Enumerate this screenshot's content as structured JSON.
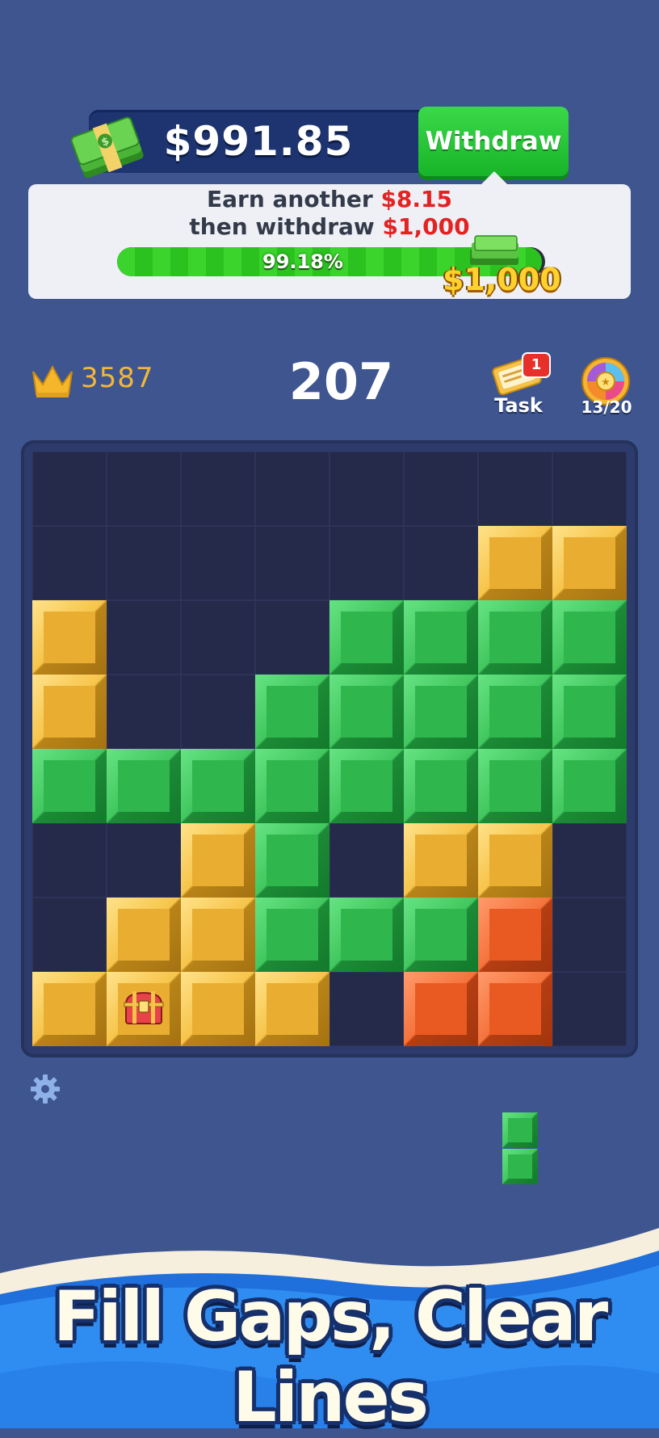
{
  "header": {
    "balance": "$991.85",
    "withdraw_label": "Withdraw"
  },
  "info_card": {
    "line1_text": "Earn another ",
    "line1_amount": "$8.15",
    "line2_text": "then withdraw ",
    "line2_amount": "$1,000",
    "progress_percent": 99.18,
    "progress_label": "99.18%",
    "prize_label": "$1,000"
  },
  "scores": {
    "best": "3587",
    "current": "207"
  },
  "task": {
    "label": "Task",
    "badge": "1"
  },
  "wheel": {
    "label": "13/20"
  },
  "board": {
    "columns": 8,
    "rows": 8,
    "grid": [
      "........",
      "......YY",
      "Y...GGGG",
      "Y..GGGGG",
      "GGGGGGGG",
      "..YG.YY.",
      ".YYGGGO.",
      "YYYY.OO."
    ],
    "chest_cell": [
      7,
      1
    ]
  },
  "next_piece": {
    "shape": "vertical-2",
    "color": "green"
  },
  "banner": {
    "slogan": "Fill Gaps, Clear Lines"
  },
  "colors": {
    "background": "#3e5590",
    "board": "#25294a",
    "green": "#2fb64d",
    "gold": "#e9ad32",
    "orange": "#e85a22",
    "accent_red": "#e42222"
  },
  "icons": [
    "cash-stack-icon",
    "crown-icon",
    "task-icon",
    "wheel-icon",
    "gear-icon",
    "treasure-chest-icon"
  ]
}
